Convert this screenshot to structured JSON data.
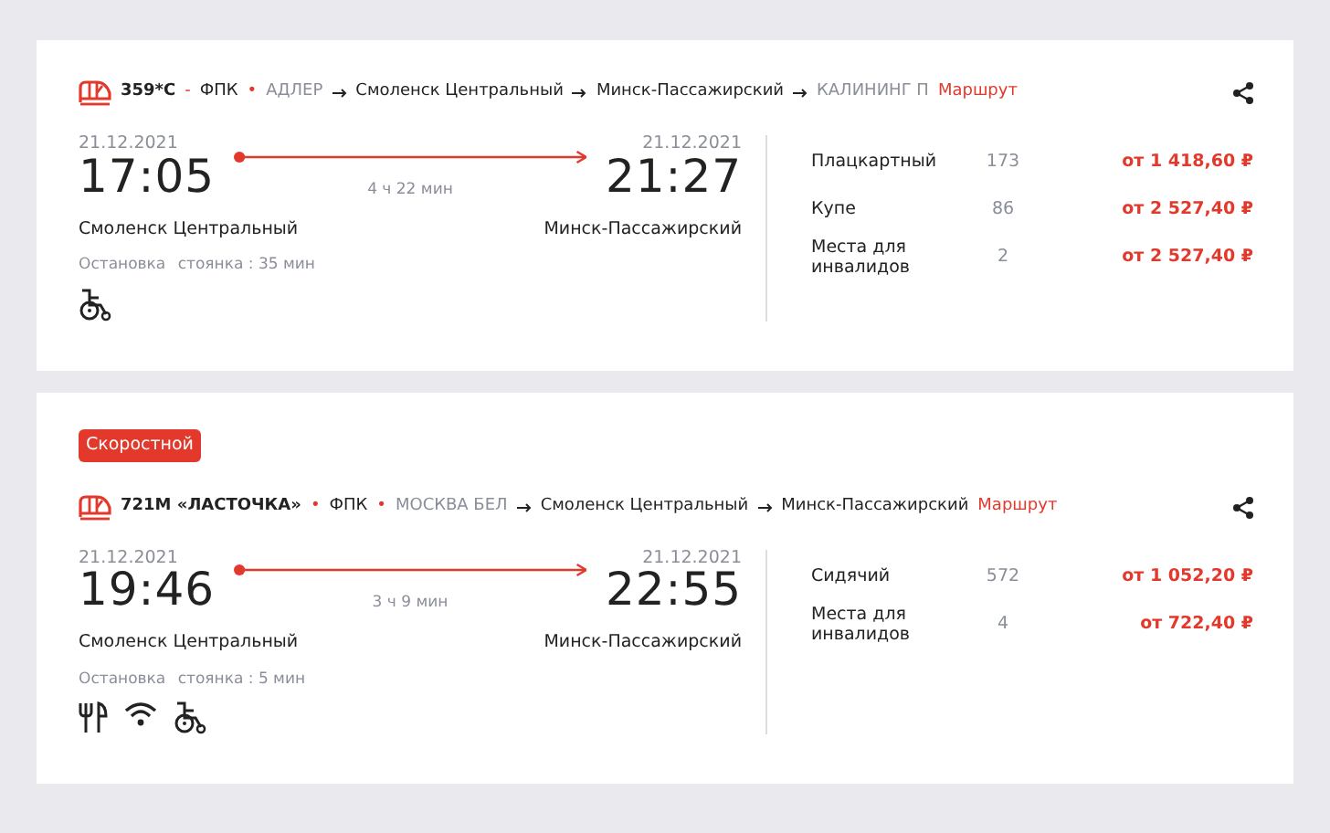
{
  "trains": [
    {
      "number": "359*С",
      "number_sep": "-",
      "carrier": "ФПК",
      "carrier_sep": "•",
      "route": [
        {
          "name": "АДЛЕР",
          "muted": true
        },
        {
          "name": "Смоленск Центральный",
          "muted": false
        },
        {
          "name": "Минск-Пассажирский",
          "muted": false
        },
        {
          "name": "КАЛИНИНГ П",
          "muted": true
        }
      ],
      "route_link": "Маршрут",
      "dep_date": "21.12.2021",
      "dep_time": "17:05",
      "arr_date": "21.12.2021",
      "arr_time": "21:27",
      "duration": "4 ч 22 мин",
      "from": "Смоленск Центральный",
      "to": "Минск-Пассажирский",
      "stop_label": "Остановка",
      "stop_info": "стоянка : 35 мин",
      "amenities": [
        {
          "kind": "wheelchair"
        }
      ],
      "fares": [
        {
          "type": "Плацкартный",
          "seats": "173",
          "price": "от 1 418,60 ₽"
        },
        {
          "type": "Купе",
          "seats": "86",
          "price": "от 2 527,40 ₽"
        },
        {
          "type": "Места для инвалидов",
          "seats": "2",
          "price": "от 2 527,40 ₽"
        }
      ]
    },
    {
      "badge": "Скоростной",
      "number": "721М «ЛАСТОЧКА»",
      "number_sep": "•",
      "carrier": "ФПК",
      "carrier_sep": "•",
      "route": [
        {
          "name": "МОСКВА БЕЛ",
          "muted": true
        },
        {
          "name": "Смоленск Центральный",
          "muted": false
        },
        {
          "name": "Минск-Пассажирский",
          "muted": false
        }
      ],
      "route_link": "Маршрут",
      "dep_date": "21.12.2021",
      "dep_time": "19:46",
      "arr_date": "21.12.2021",
      "arr_time": "22:55",
      "duration": "3 ч 9 мин",
      "from": "Смоленск Центральный",
      "to": "Минск-Пассажирский",
      "stop_label": "Остановка",
      "stop_info": "стоянка : 5 мин",
      "amenities": [
        {
          "kind": "food"
        },
        {
          "kind": "wifi"
        },
        {
          "kind": "wheelchair"
        }
      ],
      "fares": [
        {
          "type": "Сидячий",
          "seats": "572",
          "price": "от 1 052,20 ₽"
        },
        {
          "type": "Места для инвалидов",
          "seats": "4",
          "price": "от 722,40 ₽"
        }
      ]
    }
  ]
}
